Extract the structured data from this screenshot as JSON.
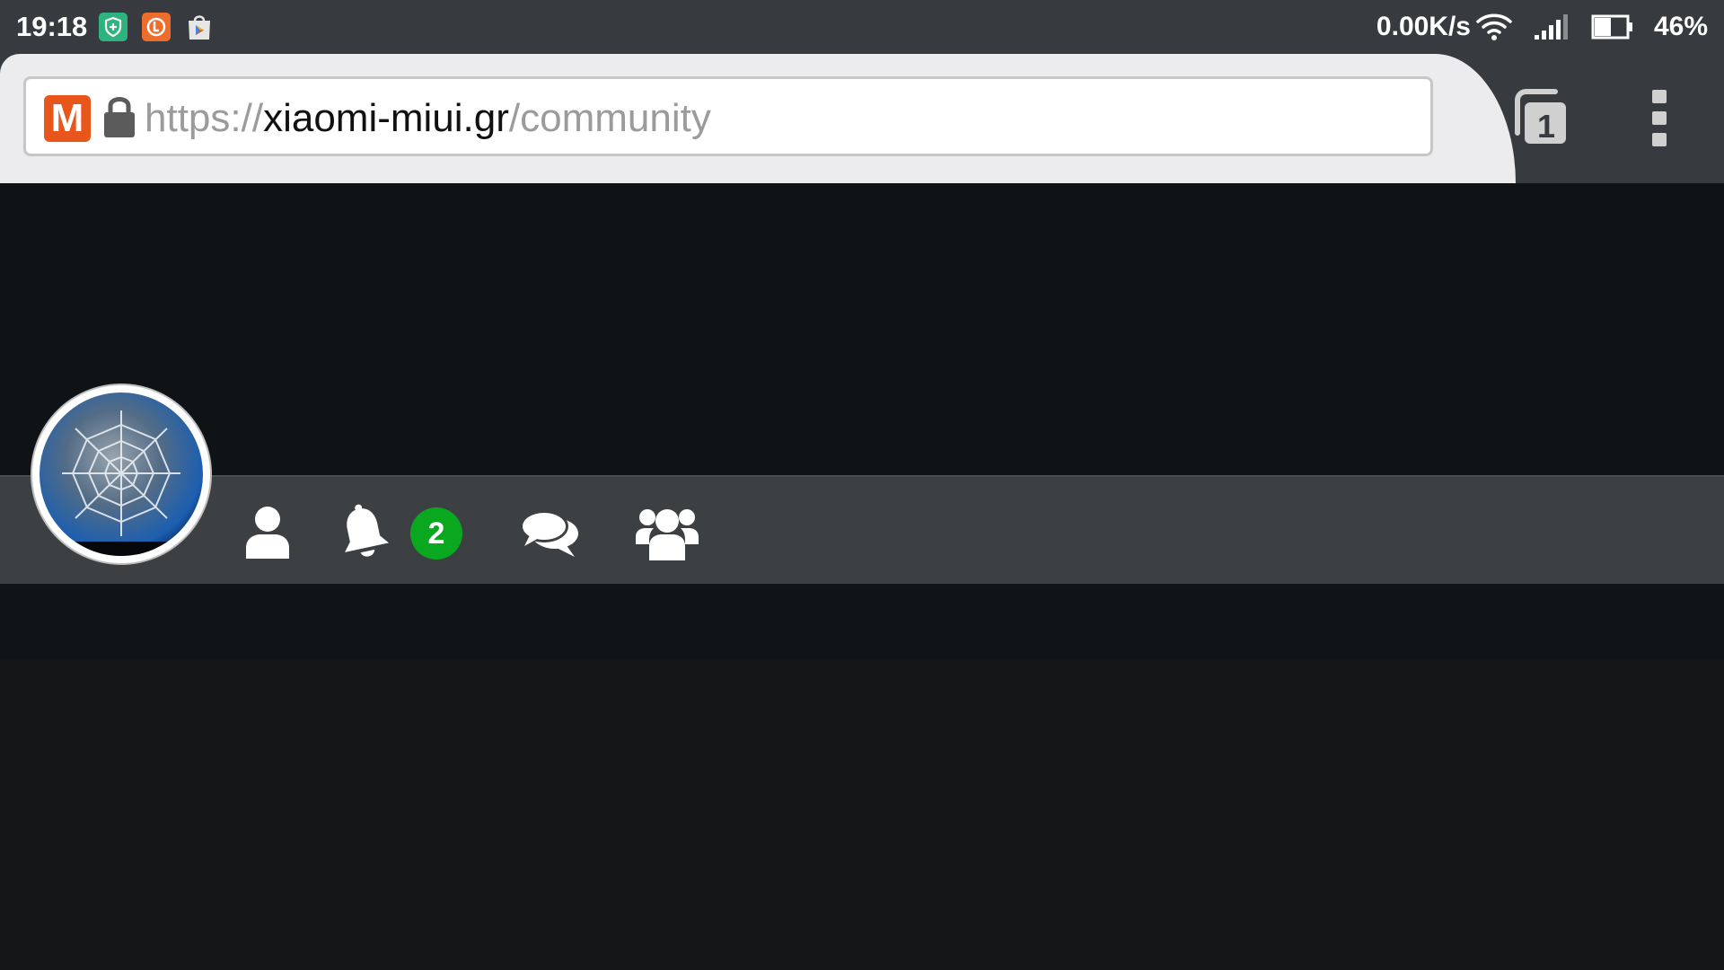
{
  "status_bar": {
    "time": "19:18",
    "net_speed": "0.00K/s",
    "battery": "46%",
    "notifications": [
      "shield-icon",
      "orange-app-icon",
      "play-store-icon"
    ]
  },
  "browser": {
    "site_logo_letter": "M",
    "url": {
      "scheme": "https://",
      "host": "xiaomi-miui.gr",
      "path": "/community"
    },
    "tab_count": "1"
  },
  "profile_nav": {
    "notification_count": "2",
    "icons": [
      "profile-icon",
      "bell-icon",
      "chat-icon",
      "groups-icon"
    ]
  },
  "colors": {
    "status_bar_bg": "#373a3e",
    "url_bar_bg": "#ecebee",
    "banner_bg": "#0f1316",
    "nav_strip_bg": "#3d4043",
    "badge_green": "#0aa81f",
    "logo_orange": "#e8561b"
  }
}
